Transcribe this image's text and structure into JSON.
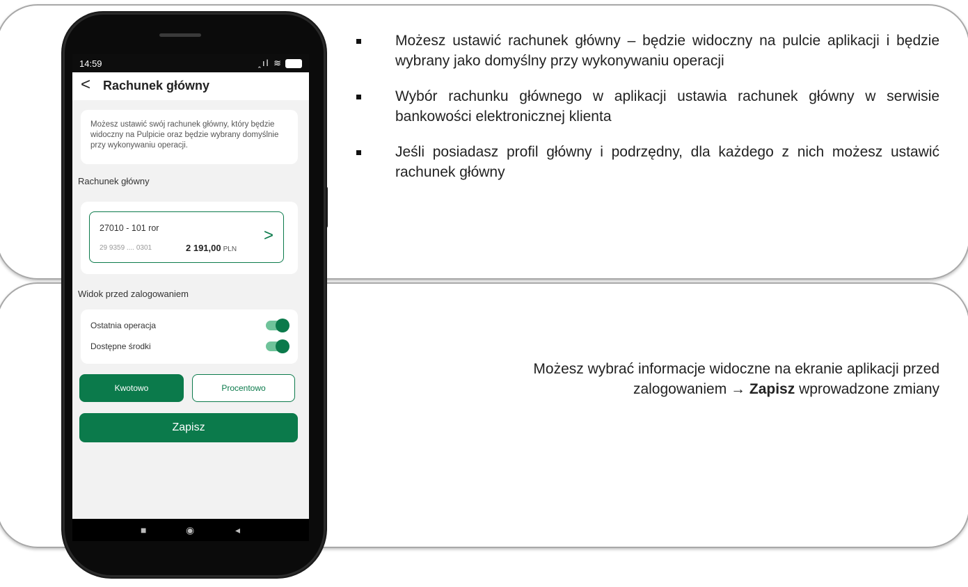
{
  "phone": {
    "status": {
      "time": "14:59",
      "icons": "ꞈıl ≋",
      "battery": "100"
    },
    "appbar": {
      "back": "<",
      "title": "Rachunek główny"
    },
    "info_text": "Możesz ustawić swój rachunek główny, który będzie widoczny na Pulpicie oraz będzie wybrany domyślnie przy wykonywaniu operacji.",
    "section_main": "Rachunek główny",
    "account": {
      "name": "27010 - 101 ror",
      "number": "29 9359 .... 0301",
      "balance": "2 191,00",
      "currency": "PLN",
      "chevron": ">"
    },
    "section_view": "Widok przed zalogowaniem",
    "toggles": [
      {
        "label": "Ostatnia operacja",
        "on": true
      },
      {
        "label": "Dostępne środki",
        "on": true
      }
    ],
    "segments": {
      "amount": "Kwotowo",
      "percent": "Procentowo",
      "selected": "Kwotowo"
    },
    "save": "Zapisz",
    "nav": {
      "square": "■",
      "circle": "◉",
      "back": "◂"
    },
    "accent": "#0b7a4b"
  },
  "bullets": [
    "Możesz ustawić rachunek główny – będzie widoczny na pulcie aplikacji i będzie wybrany jako domyślny przy wykonywaniu operacji",
    "Wybór rachunku głównego w aplikacji ustawia rachunek główny w serwisie bankowości elektronicznej klienta",
    "Jeśli posiadasz profil główny i podrzędny, dla każdego z nich możesz ustawić rachunek główny"
  ],
  "second_text": {
    "before": "Możesz wybrać informacje widoczne na ekranie aplikacji przed zalogowaniem → ",
    "bold": "Zapisz",
    "after": " wprowadzone zmiany"
  }
}
